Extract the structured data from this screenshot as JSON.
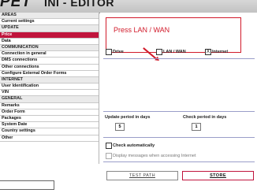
{
  "header": {
    "logo": "PET",
    "title": "INI - EDITOR"
  },
  "sidebar": {
    "items": [
      {
        "label": "AREAS",
        "kind": "section"
      },
      {
        "label": "Current settings",
        "kind": "item"
      },
      {
        "label": "UPDATE",
        "kind": "section"
      },
      {
        "label": "Price",
        "kind": "selected"
      },
      {
        "label": "Data",
        "kind": "item"
      },
      {
        "label": "COMMUNICATION",
        "kind": "section"
      },
      {
        "label": "Connection in general",
        "kind": "item"
      },
      {
        "label": "DMS connections",
        "kind": "item"
      },
      {
        "label": "Other connections",
        "kind": "item"
      },
      {
        "label": "Configure External Order Forms",
        "kind": "item"
      },
      {
        "label": "INTERNET",
        "kind": "section"
      },
      {
        "label": "User Identification",
        "kind": "item"
      },
      {
        "label": "VIN",
        "kind": "item"
      },
      {
        "label": "GENERAL",
        "kind": "section"
      },
      {
        "label": "Remarks",
        "kind": "item"
      },
      {
        "label": "Order Form",
        "kind": "item"
      },
      {
        "label": "Packages",
        "kind": "item"
      },
      {
        "label": "System Date",
        "kind": "item"
      },
      {
        "label": "Country settings",
        "kind": "item"
      },
      {
        "label": "Other",
        "kind": "item"
      }
    ]
  },
  "callout": {
    "text": "Press LAN / WAN"
  },
  "sources": {
    "drive": {
      "label": "Drive",
      "checked": false,
      "mark": ""
    },
    "lan": {
      "label": "LAN / WAN",
      "checked": false,
      "mark": ""
    },
    "internet": {
      "label": "Internet",
      "checked": true,
      "mark": "X"
    }
  },
  "periods": {
    "update_label": "Update period in days",
    "update_value": "5",
    "check_label": "Check period in days",
    "check_value": "1"
  },
  "options": {
    "check_auto": {
      "label": "Check automatically",
      "checked": false,
      "mark": ""
    },
    "display_msgs": {
      "label": "Display messages when accessing Internet",
      "checked": false,
      "mark": ""
    }
  },
  "buttons": {
    "test_path": "TEST PATH",
    "store": "STORE"
  },
  "colors": {
    "accent": "#c0143c",
    "callout": "#d11a2a",
    "divider": "#9a9ec9"
  }
}
